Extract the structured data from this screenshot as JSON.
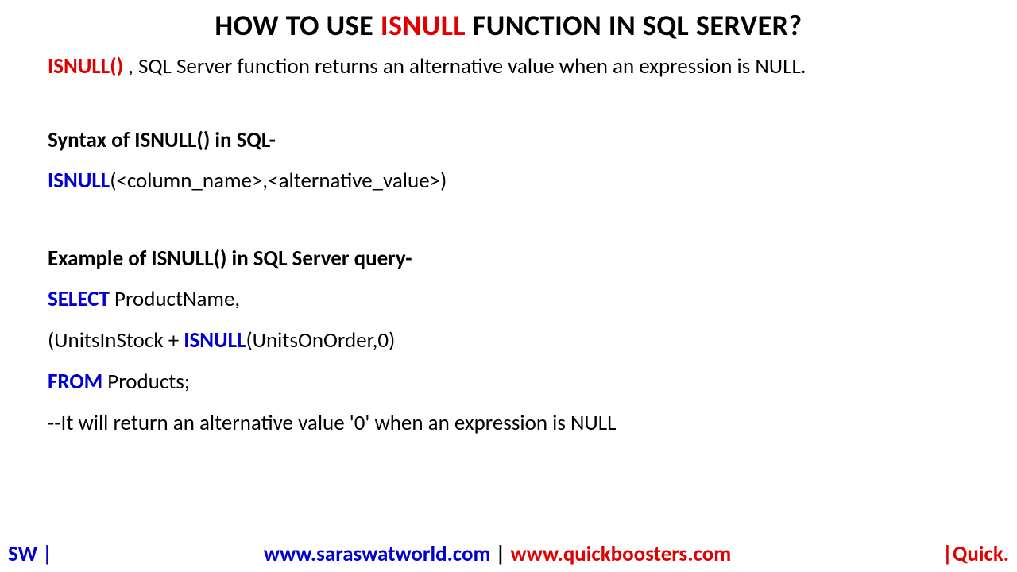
{
  "title": {
    "pre": "HOW TO USE ",
    "kw": "ISNULL",
    "post": " FUNCTION IN SQL SERVER?"
  },
  "intro": {
    "kw": "ISNULL()",
    "rest": " , SQL Server function returns an alternative value when an expression is NULL."
  },
  "syntax": {
    "heading": "Syntax of ISNULL() in SQL-",
    "kw": "ISNULL",
    "args": "(<column_name>,<alternative_value>)"
  },
  "example": {
    "heading": "Example of ISNULL() in SQL Server query-",
    "l1_kw": "SELECT",
    "l1_rest": " ProductName,",
    "l2_pre": "(UnitsInStock + ",
    "l2_kw": "ISNULL",
    "l2_post": "(UnitsOnOrder,0)",
    "l3_kw": "FROM",
    "l3_rest": " Products;",
    "comment": "--It will return an alternative value '0' when an expression is NULL"
  },
  "footer": {
    "left": "SW |",
    "url1": "www.saraswatworld.com",
    "sep": " | ",
    "url2": "www.quickboosters.com",
    "right": "|Quick."
  }
}
